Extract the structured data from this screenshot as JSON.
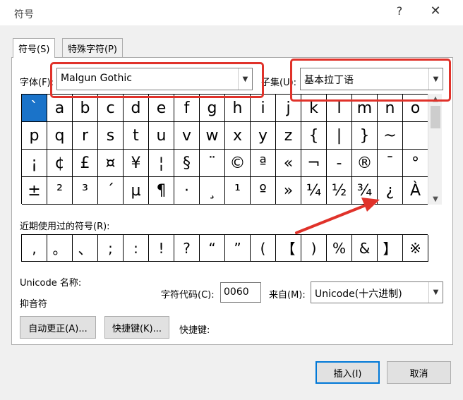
{
  "window": {
    "title": "符号",
    "help": "?",
    "close": "✕"
  },
  "tabs": [
    {
      "label": "符号(S)"
    },
    {
      "label": "特殊字符(P)"
    }
  ],
  "font": {
    "label": "字体(F):",
    "value": "Malgun Gothic"
  },
  "subset": {
    "label": "子集(U):",
    "value": "基本拉丁语"
  },
  "symbols": [
    "`",
    "a",
    "b",
    "c",
    "d",
    "e",
    "f",
    "g",
    "h",
    "i",
    "j",
    "k",
    "l",
    "m",
    "n",
    "o",
    "p",
    "q",
    "r",
    "s",
    "t",
    "u",
    "v",
    "w",
    "x",
    "y",
    "z",
    "{",
    "|",
    "}",
    "~",
    " ",
    "¡",
    "¢",
    "£",
    "¤",
    "¥",
    "¦",
    "§",
    "¨",
    "©",
    "ª",
    "«",
    "¬",
    "-",
    "®",
    "¯",
    "°",
    "±",
    "²",
    "³",
    "´",
    "µ",
    "¶",
    "·",
    "¸",
    "¹",
    "º",
    "»",
    "¼",
    "½",
    "¾",
    "¿",
    "À"
  ],
  "recent_label": "近期使用过的符号(R):",
  "recent_symbols": [
    ",",
    "。",
    "、",
    ";",
    ":",
    "!",
    "?",
    "“",
    "”",
    "(",
    "【",
    ")",
    "%",
    "&",
    "】",
    "※"
  ],
  "unicode_name_label": "Unicode 名称:",
  "unicode_name_value": "抑音符",
  "char_code": {
    "label": "字符代码(C):",
    "value": "0060"
  },
  "from": {
    "label": "来自(M):",
    "value": "Unicode(十六进制)"
  },
  "buttons": {
    "autocorrect": "自动更正(A)...",
    "shortcut_key": "快捷键(K)...",
    "shortcut_label": "快捷键:",
    "insert": "插入(I)",
    "cancel": "取消"
  },
  "icons": {
    "dropdown": "chevron-down-icon",
    "scroll_up": "chevron-up-icon",
    "scroll_down": "chevron-down-icon"
  },
  "colors": {
    "selected": "#1a73c9",
    "annotation": "#e0322a"
  }
}
